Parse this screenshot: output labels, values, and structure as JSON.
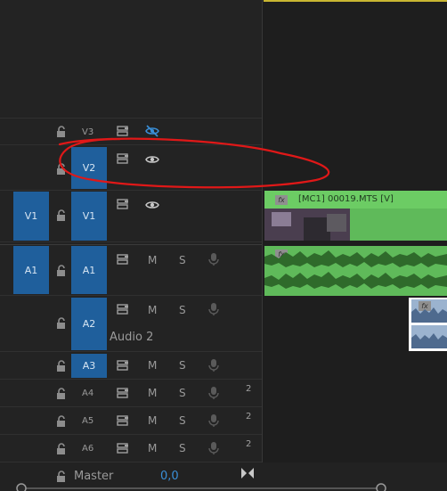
{
  "tracks": {
    "v3": {
      "name": "V3"
    },
    "v2": {
      "name": "V2"
    },
    "v1": {
      "source": "V1",
      "name": "V1"
    },
    "a1": {
      "source": "A1",
      "name": "A1",
      "mute": "M",
      "solo": "S"
    },
    "a2": {
      "name": "A2",
      "mute": "M",
      "solo": "S",
      "label": "Audio 2"
    },
    "a3": {
      "name": "A3",
      "mute": "M",
      "solo": "S"
    },
    "a4": {
      "name": "A4",
      "mute": "M",
      "solo": "S",
      "channels": "2"
    },
    "a5": {
      "name": "A5",
      "mute": "M",
      "solo": "S",
      "channels": "2"
    },
    "a6": {
      "name": "A6",
      "mute": "M",
      "solo": "S",
      "channels": "2"
    }
  },
  "master": {
    "label": "Master",
    "volume": "0,0"
  },
  "clips": {
    "video": {
      "fx": "fx",
      "title": "[MC1] 00019.MTS [V]"
    },
    "audio": {
      "fx": "fx"
    },
    "audio2": {
      "fx": "fx"
    }
  },
  "colors": {
    "track_target": "#1f5f9c",
    "clip_green": "#5fba5a",
    "annotation": "#e01818",
    "eye_hidden": "#3a8fd8"
  }
}
